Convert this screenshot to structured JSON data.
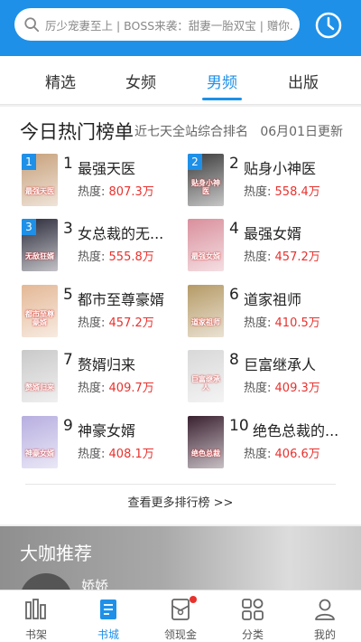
{
  "search": {
    "placeholder": "厉少宠妻至上 | BOSS来袭：甜妻一胎双宝 | 赠你..."
  },
  "tabs": [
    {
      "label": "精选"
    },
    {
      "label": "女频"
    },
    {
      "label": "男频",
      "active": true
    },
    {
      "label": "出版"
    }
  ],
  "ranking": {
    "title": "今日热门榜单",
    "subtitle": "近七天全站综合排名",
    "date": "06月01日更新",
    "heat_label": "热度:",
    "items": [
      {
        "rank": "1",
        "badge": "1",
        "title": "最强天医",
        "heat": "807.3万",
        "cover_text": "最强天医",
        "cover_color": "#c7a07a"
      },
      {
        "rank": "2",
        "badge": "2",
        "title": "贴身小神医",
        "heat": "558.4万",
        "cover_text": "贴身小神医",
        "cover_color": "#3b3b3b"
      },
      {
        "rank": "3",
        "badge": "3",
        "title": "女总裁的无...",
        "heat": "555.8万",
        "cover_text": "无敌狂婿",
        "cover_color": "#2a2a3a"
      },
      {
        "rank": "4",
        "title": "最强女婿",
        "heat": "457.2万",
        "cover_text": "最强女婿",
        "cover_color": "#d98f9c"
      },
      {
        "rank": "5",
        "title": "都市至尊豪婿",
        "heat": "457.2万",
        "cover_text": "都市至尊豪婿",
        "cover_color": "#e4b896"
      },
      {
        "rank": "6",
        "title": "道家祖师",
        "heat": "410.5万",
        "cover_text": "道家祖师",
        "cover_color": "#b59a66"
      },
      {
        "rank": "7",
        "title": "赘婿归来",
        "heat": "409.7万",
        "cover_text": "赘婿归来",
        "cover_color": "#c9c9c9"
      },
      {
        "rank": "8",
        "title": "巨富继承人",
        "heat": "409.3万",
        "cover_text": "巨富继承人",
        "cover_color": "#d8d8d8"
      },
      {
        "rank": "9",
        "title": "神豪女婿",
        "heat": "408.1万",
        "cover_text": "神豪女婿",
        "cover_color": "#b7aee0"
      },
      {
        "rank": "10",
        "title": "绝色总裁的...",
        "heat": "406.6万",
        "cover_text": "绝色总裁",
        "cover_color": "#3a2030"
      }
    ],
    "more": "查看更多排行榜 >>"
  },
  "recommend": {
    "title": "大咖推荐",
    "name": "娇娇"
  },
  "bottom_nav": [
    {
      "label": "书架",
      "icon": "bookshelf-icon"
    },
    {
      "label": "书城",
      "icon": "bookstore-icon",
      "active": true
    },
    {
      "label": "领现金",
      "icon": "cash-icon",
      "dot": true
    },
    {
      "label": "分类",
      "icon": "category-icon"
    },
    {
      "label": "我的",
      "icon": "profile-icon"
    }
  ],
  "colors": {
    "accent": "#1e90e8",
    "heat": "#e8322e"
  }
}
